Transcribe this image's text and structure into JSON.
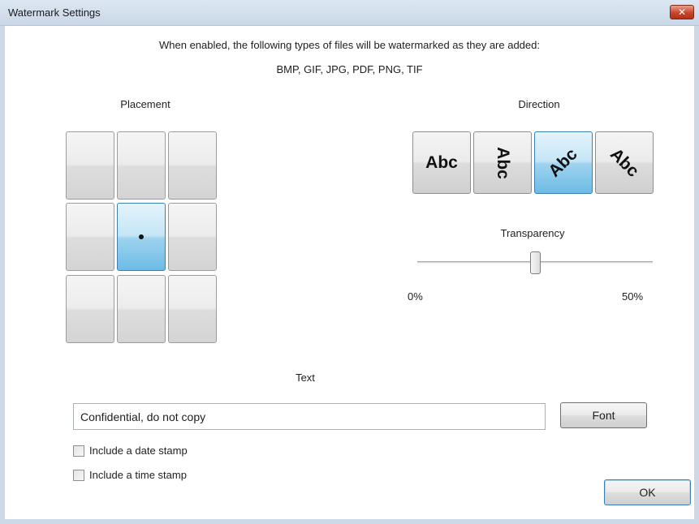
{
  "window": {
    "title": "Watermark Settings",
    "close_glyph": "✕"
  },
  "intro": {
    "line1": "When enabled, the following types of files will be watermarked as they are added:",
    "line2": "BMP, GIF, JPG, PDF, PNG, TIF"
  },
  "placement": {
    "label": "Placement",
    "selected": "middle-center",
    "cells": [
      "top-left",
      "top-center",
      "top-right",
      "middle-left",
      "middle-center",
      "middle-right",
      "bottom-left",
      "bottom-center",
      "bottom-right"
    ]
  },
  "direction": {
    "label": "Direction",
    "options": [
      {
        "id": "horizontal",
        "text": "Abc",
        "selected": false
      },
      {
        "id": "vertical",
        "text": "Abc",
        "selected": false
      },
      {
        "id": "diagonal-up",
        "text": "Abc",
        "selected": true
      },
      {
        "id": "diagonal-down",
        "text": "Abc",
        "selected": false
      }
    ]
  },
  "transparency": {
    "label": "Transparency",
    "min_label": "0%",
    "max_label": "50%",
    "value_fraction": 0.5
  },
  "text_section": {
    "label": "Text",
    "value": "Confidential, do not copy",
    "font_button": "Font"
  },
  "options": {
    "date_stamp": {
      "label": "Include a date stamp",
      "checked": false
    },
    "time_stamp": {
      "label": "Include a time stamp",
      "checked": false
    }
  },
  "footer": {
    "ok_button": "OK"
  },
  "colors": {
    "selected_blue": "#6cbbe6",
    "close_red": "#c7462b"
  }
}
